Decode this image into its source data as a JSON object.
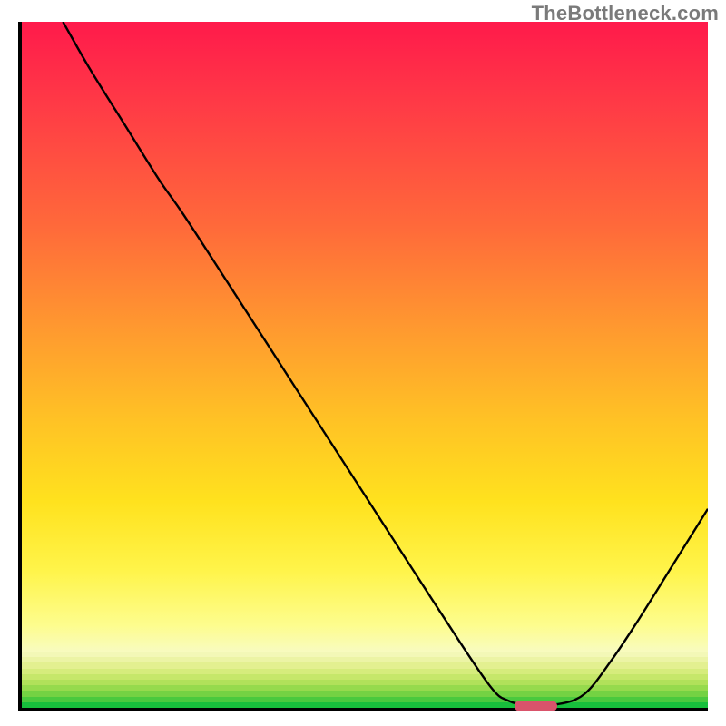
{
  "watermark": "TheBottleneck.com",
  "chart_data": {
    "type": "line",
    "title": "",
    "xlabel": "",
    "ylabel": "",
    "xlim": [
      0,
      100
    ],
    "ylim": [
      0,
      100
    ],
    "grid": false,
    "legend": false,
    "series": [
      {
        "name": "curve",
        "x": [
          6,
          10,
          15,
          20,
          23.5,
          30,
          40,
          50,
          60,
          68,
          71,
          74,
          78,
          82,
          86,
          90,
          95,
          100
        ],
        "y": [
          100,
          93,
          85,
          77,
          72,
          62,
          46.5,
          31,
          15.5,
          3.5,
          1,
          0.5,
          0.5,
          2,
          7,
          13,
          21,
          29
        ],
        "note": "Values are percentages of axis range; y=0 at bottom axis. Curve starts at top-left edge, descends with a slight kink near x≈23.5, bottoms out around x≈74–78, then rises toward the right edge."
      }
    ],
    "marker": {
      "shape": "rounded-rect",
      "x": 74.5,
      "y": 0.8,
      "width_pct": 6.2,
      "height_pct": 1.6,
      "color": "#d9536b"
    },
    "background_gradient": {
      "stops": [
        {
          "pct": 0,
          "color": "#ff1a4b"
        },
        {
          "pct": 30,
          "color": "#ff6a3a"
        },
        {
          "pct": 58,
          "color": "#ffc225"
        },
        {
          "pct": 80,
          "color": "#fff44a"
        },
        {
          "pct": 92,
          "color": "#f8fbc2"
        }
      ],
      "bottom_bands": [
        "#f3f8b7",
        "#ecf4a5",
        "#e3f090",
        "#d6ec7c",
        "#c6e76a",
        "#b1e15a",
        "#96da4d",
        "#74d243",
        "#4ac93e",
        "#17bf3c"
      ]
    }
  }
}
